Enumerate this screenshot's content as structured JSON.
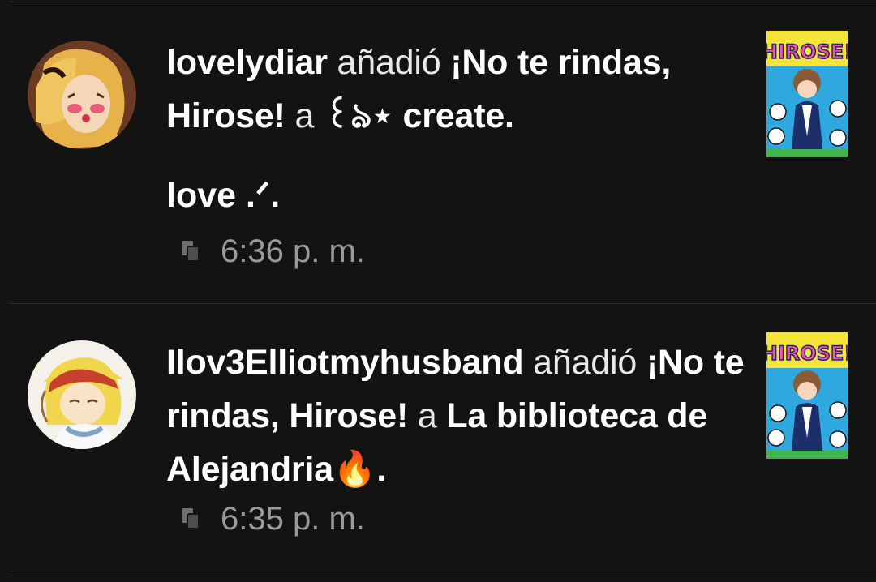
{
  "feed": {
    "items": [
      {
        "username": "lovelydiar",
        "verb": "añadió",
        "book_title": "¡No te rindas, Hirose!",
        "connector": "a",
        "list_name": "꒰ঌ⋆ create",
        "period": ".",
        "comment": "love .ᐟ.",
        "timestamp": "6:36 p. m.",
        "avatar_icon": "user-avatar",
        "cover_icon": "book-cover",
        "cover_title": "HIROSE!"
      },
      {
        "username": "Ilov3Elliotmyhusband",
        "verb": "añadió",
        "book_title": "¡No te rindas, Hirose!",
        "connector": "a",
        "list_name": "La biblioteca de Alejandria🔥",
        "period": ".",
        "timestamp": "6:35 p. m.",
        "avatar_icon": "user-avatar",
        "cover_icon": "book-cover",
        "cover_title": "HIROSE!"
      }
    ]
  },
  "colors": {
    "background": "#131313",
    "divider": "#2c2c2c",
    "meta_text": "#9a9a9a",
    "primary_text": "#ffffff"
  }
}
